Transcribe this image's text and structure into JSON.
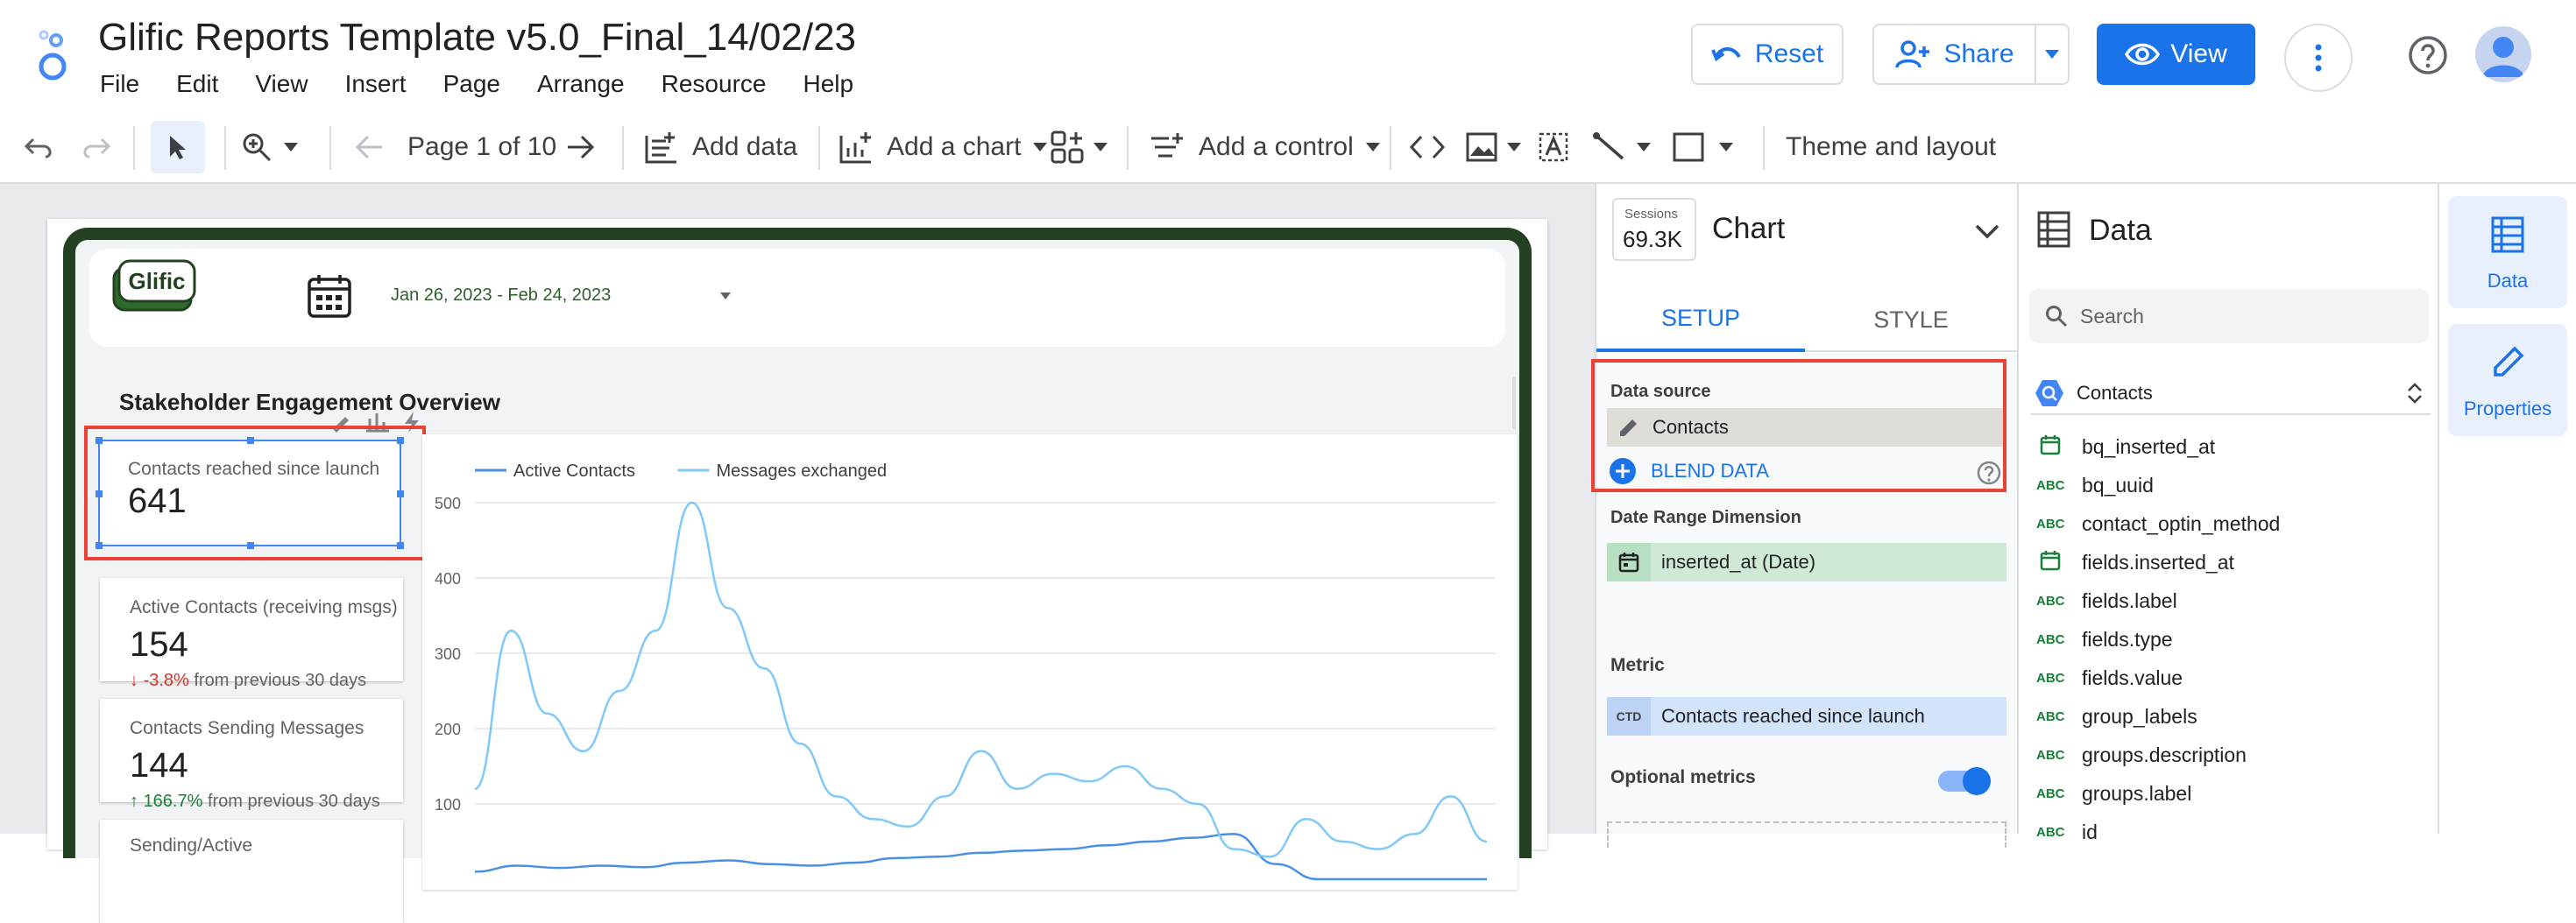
{
  "header": {
    "title": "Glific Reports Template v5.0_Final_14/02/23",
    "menu": [
      "File",
      "Edit",
      "View",
      "Insert",
      "Page",
      "Arrange",
      "Resource",
      "Help"
    ],
    "reset_label": "Reset",
    "share_label": "Share",
    "view_label": "View"
  },
  "toolbar": {
    "page_label": "Page 1 of 10",
    "add_data": "Add data",
    "add_chart": "Add a chart",
    "add_control": "Add a control",
    "theme": "Theme and layout"
  },
  "report": {
    "logo_text": "Glific",
    "date_range": "Jan 26, 2023 - Feb 24, 2023",
    "section_title": "Stakeholder Engagement Overview",
    "kpis": [
      {
        "label": "Contacts reached since launch",
        "value": "641"
      },
      {
        "label": "Active Contacts (receiving msgs)",
        "value": "154",
        "delta": "-3.8%",
        "delta_suffix": "from previous 30 days",
        "dir": "down"
      },
      {
        "label": "Contacts Sending Messages",
        "value": "144",
        "delta": "166.7%",
        "delta_suffix": "from previous 30 days",
        "dir": "up"
      },
      {
        "label": "Sending/Active",
        "value": ""
      }
    ]
  },
  "chart_data": {
    "type": "line",
    "series": [
      {
        "name": "Active Contacts",
        "color": "#4a90e2",
        "values": [
          10,
          18,
          15,
          18,
          16,
          22,
          25,
          20,
          18,
          22,
          28,
          30,
          35,
          38,
          40,
          45,
          50,
          55,
          60,
          20,
          0,
          0,
          0,
          0,
          0
        ]
      },
      {
        "name": "Messages exchanged",
        "color": "#7fc8f8",
        "values": [
          120,
          330,
          220,
          170,
          250,
          330,
          500,
          360,
          280,
          180,
          110,
          80,
          70,
          110,
          170,
          120,
          140,
          130,
          150,
          120,
          100,
          40,
          30,
          80,
          50,
          40,
          60,
          110,
          50
        ]
      }
    ],
    "ylim": [
      0,
      500
    ],
    "yticks": [
      "500",
      "400",
      "300",
      "200",
      "100"
    ]
  },
  "chart_panel": {
    "sessions_label": "Sessions",
    "sessions_value": "69.3K",
    "title": "Chart",
    "tab_setup": "SETUP",
    "tab_style": "STYLE",
    "data_source_label": "Data source",
    "data_source_value": "Contacts",
    "blend_label": "BLEND DATA",
    "date_range_dim_label": "Date Range Dimension",
    "date_range_dim_value": "inserted_at (Date)",
    "metric_label": "Metric",
    "metric_badge": "CTD",
    "metric_value": "Contacts reached since launch",
    "optional_metrics_label": "Optional metrics"
  },
  "data_panel": {
    "title": "Data",
    "search_placeholder": "Search",
    "source": "Contacts",
    "fields": [
      {
        "type": "date",
        "name": "bq_inserted_at"
      },
      {
        "type": "ABC",
        "name": "bq_uuid"
      },
      {
        "type": "ABC",
        "name": "contact_optin_method"
      },
      {
        "type": "date",
        "name": "fields.inserted_at"
      },
      {
        "type": "ABC",
        "name": "fields.label"
      },
      {
        "type": "ABC",
        "name": "fields.type"
      },
      {
        "type": "ABC",
        "name": "fields.value"
      },
      {
        "type": "ABC",
        "name": "group_labels"
      },
      {
        "type": "ABC",
        "name": "groups.description"
      },
      {
        "type": "ABC",
        "name": "groups.label"
      },
      {
        "type": "ABC",
        "name": "id"
      }
    ]
  },
  "rail": {
    "data_label": "Data",
    "properties_label": "Properties"
  },
  "colors": {
    "accent": "#1a73e8",
    "highlight": "#ea4335",
    "frame": "#234120"
  }
}
